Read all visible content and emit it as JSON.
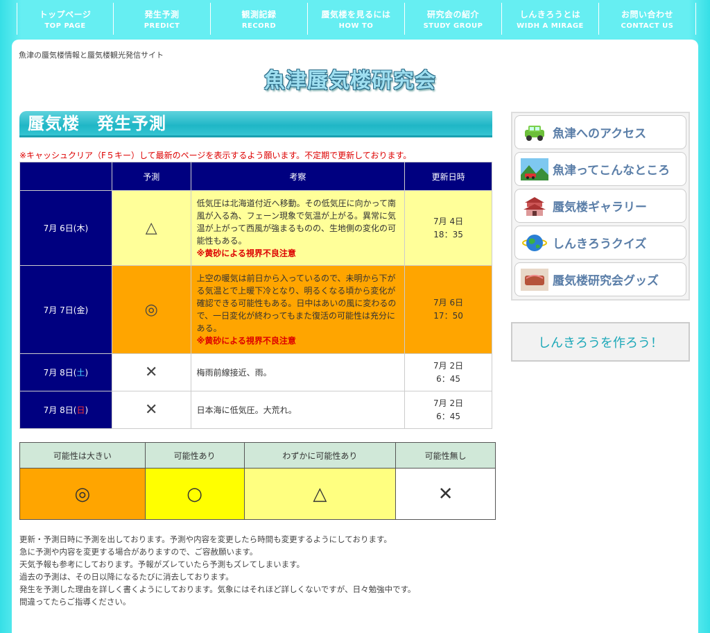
{
  "nav": [
    {
      "jp": "トップページ",
      "en": "TOP PAGE"
    },
    {
      "jp": "発生予測",
      "en": "PREDICT"
    },
    {
      "jp": "観測記録",
      "en": "RECORD"
    },
    {
      "jp": "蜃気楼を見るには",
      "en": "HOW TO"
    },
    {
      "jp": "研究会の紹介",
      "en": "STUDY GROUP"
    },
    {
      "jp": "しんきろうとは",
      "en": "WIDH A MIRAGE"
    },
    {
      "jp": "お問い合わせ",
      "en": "CONTACT US"
    }
  ],
  "tagline": "魚津の蜃気楼情報と蜃気楼観光発信サイト",
  "logo": "魚津蜃気楼研究会",
  "page_title": "蜃気楼　発生予測",
  "notice": "※キャッシュクリア（F５キー）して最新のページを表示するよう願います。不定期で更新しております。",
  "table": {
    "headers": [
      "",
      "予測",
      "考察",
      "更新日時"
    ],
    "rows": [
      {
        "date_pre": "7月 6日(",
        "day": "木",
        "date_post": ")",
        "prediction": "△",
        "comment": "低気圧は北海道付近へ移動。その低気圧に向かって南風が入る為、フェーン現象で気温が上がる。異常に気温が上がって西風が強まるものの、生地側の変化の可能性もある。",
        "warning": "※黄砂による視界不良注意",
        "updated_date": "7月 4日",
        "updated_time": "18：35"
      },
      {
        "date_pre": "7月 7日(",
        "day": "金",
        "date_post": ")",
        "prediction": "◎",
        "comment": "上空の暖気は前日から入っているので、未明から下がる気温とで上暖下冷となり、明るくなる頃から変化が確認できる可能性もある。日中はあいの風に変わるので、一日変化が終わってもまた復活の可能性は充分にある。",
        "warning": "※黄砂による視界不良注意",
        "updated_date": "7月 6日",
        "updated_time": "17：50"
      },
      {
        "date_pre": "7月 8日(",
        "day": "土",
        "date_post": ")",
        "prediction": "✕",
        "comment": "梅雨前線接近、雨。",
        "warning": "",
        "updated_date": "7月 2日",
        "updated_time": "6：45"
      },
      {
        "date_pre": "7月 8日(",
        "day": "日",
        "date_post": ")",
        "prediction": "✕",
        "comment": "日本海に低気圧。大荒れ。",
        "warning": "",
        "updated_date": "7月 2日",
        "updated_time": "6：45"
      }
    ]
  },
  "legend": {
    "headers": [
      "可能性は大きい",
      "可能性あり",
      "わずかに可能性あり",
      "可能性無し"
    ],
    "symbols": [
      "◎",
      "○",
      "△",
      "✕"
    ],
    "colors": [
      "#ffa500",
      "#ffff00",
      "#ffff80",
      "#ffffff"
    ]
  },
  "notes": [
    "更新・予測日時に予測を出しております。予測や内容を変更したら時間も変更するようにしております。",
    "急に予測や内容を変更する場合がありますので、ご容赦願います。",
    "天気予報も参考にしております。予報がズレていたら予測もズレてしまいます。",
    "過去の予測は、その日以降になるたびに消去しております。",
    "発生を予測した理由を詳しく書くようにしております。気象にはそれほど詳しくないですが、日々勉強中です。",
    "間違ってたらご指導ください。"
  ],
  "sidebar": {
    "items": [
      {
        "label": "魚津へのアクセス",
        "icon": "car-icon"
      },
      {
        "label": "魚津ってこんなところ",
        "icon": "landscape-icon"
      },
      {
        "label": "蜃気楼ギャラリー",
        "icon": "castle-icon"
      },
      {
        "label": "しんきろうクイズ",
        "icon": "globe-icon"
      },
      {
        "label": "蜃気楼研究会グッズ",
        "icon": "goods-icon"
      }
    ],
    "make_label": "しんきろうを作ろう！"
  }
}
